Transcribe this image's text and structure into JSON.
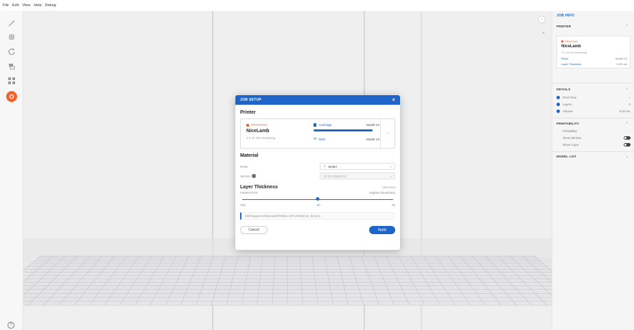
{
  "menu": [
    "File",
    "Edit",
    "View",
    "Help",
    "Debug"
  ],
  "toolbar_icons": [
    "magic-wand-icon",
    "import-icon",
    "rotate-icon",
    "layers-icon",
    "grid-icon",
    "support-icon"
  ],
  "accent": "#1f65c9",
  "warning_color": "#f0652f",
  "viewport": {
    "scroll_button": "›"
  },
  "job_info": {
    "title": "JOB INFO",
    "printer": {
      "heading": "PRINTER",
      "status": "PRINTING",
      "name": "NiceLamb",
      "remaining": "1 h 10 min remaining",
      "rows": [
        {
          "label": "Resin",
          "value": "Model V2"
        },
        {
          "label": "Layer Thickness",
          "value": "0.05 mm"
        }
      ]
    },
    "details": {
      "heading": "DETAILS",
      "rows": [
        {
          "label": "Print Time",
          "value": "–"
        },
        {
          "label": "Layers",
          "value": "0"
        },
        {
          "label": "Volume",
          "value": "0.00 mL"
        }
      ]
    },
    "printability": {
      "heading": "PRINTABILITY",
      "rows": [
        {
          "label": "Printability",
          "value": ""
        },
        {
          "label": "Show Minima",
          "value": ""
        },
        {
          "label": "Show Cups",
          "value": ""
        }
      ]
    },
    "model_list": {
      "heading": "MODEL LIST"
    }
  },
  "dialog": {
    "title": "JOB SETUP",
    "close": "×",
    "printer_section": "Printer",
    "printer": {
      "status": "PRINTING",
      "name": "NiceLamb",
      "remaining": "1 h 10 min remaining",
      "cartridge_label": "Cartridge",
      "cartridge_value": "Model V2",
      "cartridge_level": 0.9,
      "tank_label": "Tank",
      "tank_value": "Model V2"
    },
    "material_section": "Material",
    "resin": {
      "label": "Resin",
      "value": "Model"
    },
    "version": {
      "label": "Version",
      "value": "V2 (FLGMBEG2)"
    },
    "layer": {
      "title": "Layer Thickness",
      "unit": "(microns)",
      "left_label": "Fastest Print",
      "right_label": "Highest Resolution",
      "ticks": [
        "100",
        "50",
        "25"
      ],
      "selected": "50"
    },
    "path": "/db/Daguerre/Materials/FRMB-2.0/FLGMBEG2_50.json",
    "cancel": "Cancel",
    "apply": "Apply"
  },
  "help": "?"
}
